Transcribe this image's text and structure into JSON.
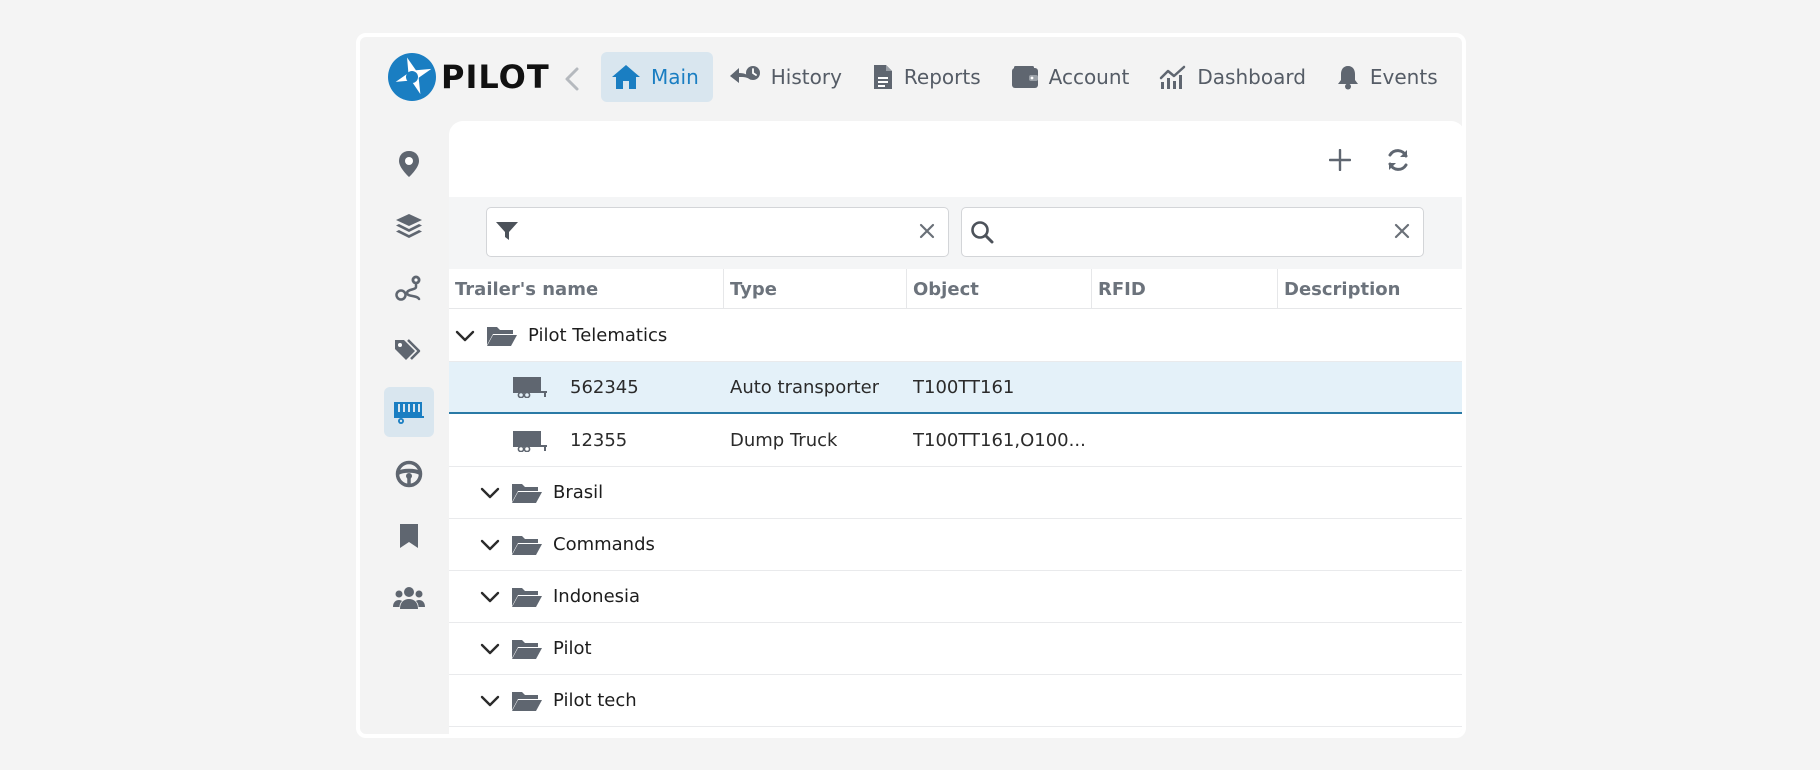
{
  "brand": {
    "name": "PILOT"
  },
  "nav": {
    "items": [
      {
        "key": "main",
        "label": "Main",
        "icon": "home-icon",
        "active": true
      },
      {
        "key": "history",
        "label": "History",
        "icon": "history-icon",
        "active": false
      },
      {
        "key": "reports",
        "label": "Reports",
        "icon": "file-icon",
        "active": false
      },
      {
        "key": "account",
        "label": "Account",
        "icon": "wallet-icon",
        "active": false
      },
      {
        "key": "dashboard",
        "label": "Dashboard",
        "icon": "chart-icon",
        "active": false
      },
      {
        "key": "events",
        "label": "Events",
        "icon": "bell-icon",
        "active": false
      }
    ]
  },
  "rail": {
    "items": [
      {
        "icon": "map-pin-icon",
        "active": false
      },
      {
        "icon": "layers-icon",
        "active": false
      },
      {
        "icon": "route-icon",
        "active": false
      },
      {
        "icon": "tags-icon",
        "active": false
      },
      {
        "icon": "trailer-icon",
        "active": true
      },
      {
        "icon": "steering-wheel-icon",
        "active": false
      },
      {
        "icon": "bookmark-icon",
        "active": false
      },
      {
        "icon": "users-icon",
        "active": false
      }
    ]
  },
  "filters": {
    "filter_value": "",
    "search_value": ""
  },
  "table": {
    "columns": [
      "Trailer's name",
      "Type",
      "Object",
      "RFID",
      "Description"
    ],
    "root_group": "Pilot Telematics",
    "rows": [
      {
        "name": "562345",
        "type": "Auto transporter",
        "object": "T100TT161",
        "rfid": "",
        "description": "",
        "selected": true
      },
      {
        "name": "12355",
        "type": "Dump Truck",
        "object": "T100TT161,O100...",
        "rfid": "",
        "description": "",
        "selected": false
      }
    ],
    "subgroups": [
      "Brasil",
      "Commands",
      "Indonesia",
      "Pilot",
      "Pilot tech"
    ]
  },
  "colors": {
    "accent": "#1a7ec2",
    "active_bg": "#d9e6ef",
    "icon_gray": "#5f6670",
    "selected_row": "#e4f1f9"
  }
}
